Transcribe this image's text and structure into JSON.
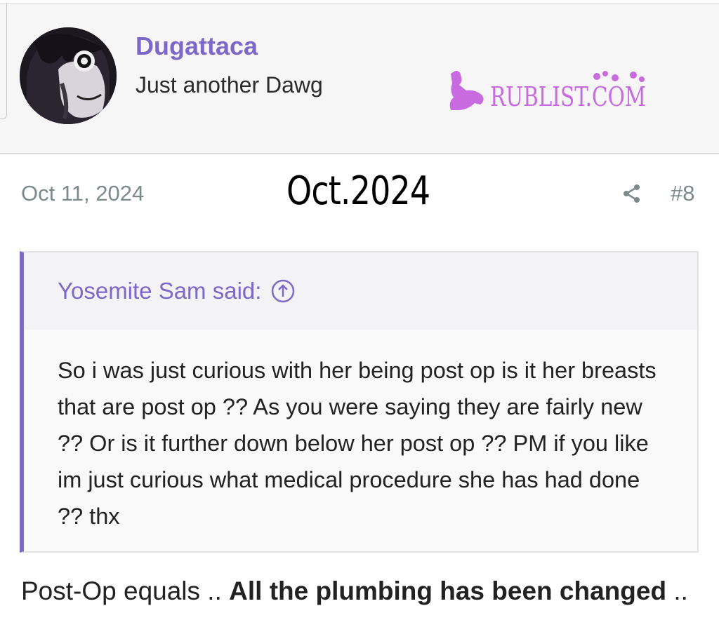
{
  "post": {
    "username": "Dugattaca",
    "user_title": "Just another Dawg",
    "date": "Oct 11, 2024",
    "post_number": "#8",
    "watermark_text": "RUBLIST.COM"
  },
  "overlay_caption": "Oct.2024",
  "quote": {
    "author_said": "Yosemite Sam said:",
    "body": "So i was just curious with her being post op is it her breasts that are post op ?? As you were saying they are fairly new ?? Or is it further down below her post op ?? PM if you like im just curious what medical procedure she has had done ?? thx"
  },
  "reply": {
    "prefix": "Post-Op equals .. ",
    "bold": "All the plumbing has been changed",
    "suffix": " .."
  },
  "icons": {
    "share": "share-icon",
    "jump": "arrow-up-circle-icon"
  },
  "colors": {
    "accent": "#7b68c8",
    "meta": "#7c8a8a",
    "watermark": "#c86be0"
  }
}
